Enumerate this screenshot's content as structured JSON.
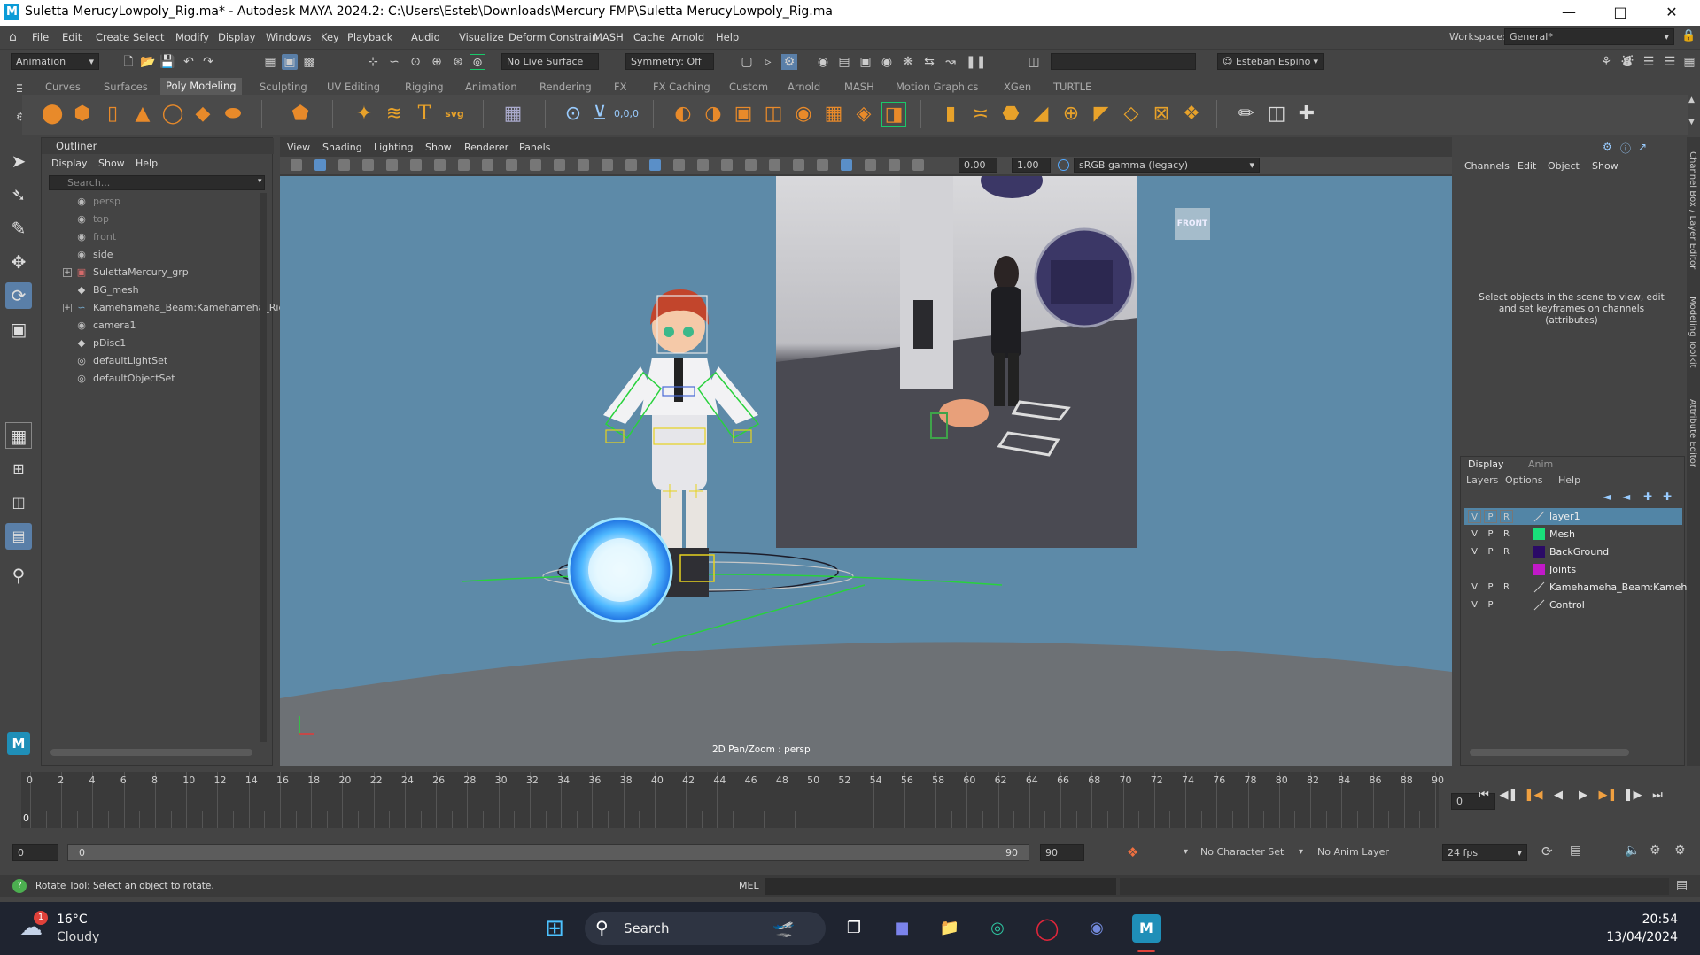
{
  "window": {
    "title": "Suletta MerucyLowpoly_Rig.ma* - Autodesk MAYA 2024.2: C:\\Users\\Esteb\\Downloads\\Mercury FMP\\Suletta MerucyLowpoly_Rig.ma",
    "app_icon": "M"
  },
  "menubar": {
    "items": [
      "File",
      "Edit",
      "Create",
      "Select",
      "Modify",
      "Display",
      "Windows",
      "Key",
      "Playback",
      "Audio",
      "Visualize",
      "Deform",
      "Constrain",
      "MASH",
      "Cache",
      "Arnold",
      "Help"
    ],
    "workspace_label": "Workspace:",
    "workspace_value": "General*"
  },
  "statusline": {
    "menuset": "Animation",
    "live_surface": "No Live Surface",
    "symmetry": "Symmetry: Off",
    "user": "Esteban Espino"
  },
  "shelf_tabs": [
    "Curves",
    "Surfaces",
    "Poly Modeling",
    "Sculpting",
    "UV Editing",
    "Rigging",
    "Animation",
    "Rendering",
    "FX",
    "FX Caching",
    "Custom",
    "Arnold",
    "MASH",
    "Motion Graphics",
    "XGen",
    "TURTLE"
  ],
  "shelf_active": "Poly Modeling",
  "outliner": {
    "title": "Outliner",
    "menu": [
      "Display",
      "Show",
      "Help"
    ],
    "search_placeholder": "Search...",
    "items": [
      {
        "label": "persp",
        "dim": true,
        "expand": false,
        "icon": "camera-icon"
      },
      {
        "label": "top",
        "dim": true,
        "expand": false,
        "icon": "camera-icon"
      },
      {
        "label": "front",
        "dim": true,
        "expand": false,
        "icon": "camera-icon"
      },
      {
        "label": "side",
        "dim": false,
        "expand": false,
        "icon": "camera-icon"
      },
      {
        "label": "SulettaMercury_grp",
        "dim": false,
        "expand": true,
        "icon": "group-icon"
      },
      {
        "label": "BG_mesh",
        "dim": false,
        "expand": false,
        "icon": "mesh-icon"
      },
      {
        "label": "Kamehameha_Beam:Kamehameha_Rig",
        "dim": false,
        "expand": true,
        "icon": "curve-icon"
      },
      {
        "label": "camera1",
        "dim": false,
        "expand": false,
        "icon": "camera-icon"
      },
      {
        "label": "pDisc1",
        "dim": false,
        "expand": false,
        "icon": "mesh-icon"
      },
      {
        "label": "defaultLightSet",
        "dim": false,
        "expand": false,
        "icon": "set-icon"
      },
      {
        "label": "defaultObjectSet",
        "dim": false,
        "expand": false,
        "icon": "set-icon"
      }
    ]
  },
  "viewport": {
    "menu": [
      "View",
      "Shading",
      "Lighting",
      "Show",
      "Renderer",
      "Panels"
    ],
    "exposure": "0.00",
    "gamma": "1.00",
    "colorspace": "sRGB gamma (legacy)",
    "view_cube": "FRONT",
    "hud": "2D Pan/Zoom : persp"
  },
  "channelbox": {
    "menu": [
      "Channels",
      "Edit",
      "Object",
      "Show"
    ],
    "message": "Select objects in the scene to view, edit and set keyframes on channels (attributes)"
  },
  "layers": {
    "tabs": [
      "Display",
      "Anim"
    ],
    "menu": [
      "Layers",
      "Options",
      "Help"
    ],
    "rows": [
      {
        "v": "V",
        "p": "P",
        "r": "R",
        "color": "",
        "name": "layer1",
        "selected": true
      },
      {
        "v": "V",
        "p": "P",
        "r": "R",
        "color": "#19e07a",
        "name": "Mesh",
        "selected": false
      },
      {
        "v": "V",
        "p": "P",
        "r": "R",
        "color": "#2a0a66",
        "name": "BackGround",
        "selected": false
      },
      {
        "v": "",
        "p": "",
        "r": "",
        "color": "#c219c9",
        "name": "Joints",
        "selected": false
      },
      {
        "v": "V",
        "p": "P",
        "r": "R",
        "color": "",
        "name": "Kamehameha_Beam:Kamehameha",
        "selected": false
      },
      {
        "v": "V",
        "p": "P",
        "r": "",
        "color": "",
        "name": "Control",
        "selected": false
      }
    ]
  },
  "right_strip": [
    "Channel Box / Layer Editor",
    "Modeling Toolkit",
    "Attribute Editor"
  ],
  "timeline": {
    "ticks": [
      "0",
      "2",
      "4",
      "6",
      "8",
      "10",
      "12",
      "14",
      "16",
      "18",
      "20",
      "22",
      "24",
      "26",
      "28",
      "30",
      "32",
      "34",
      "36",
      "38",
      "40",
      "42",
      "44",
      "46",
      "48",
      "50",
      "52",
      "54",
      "56",
      "58",
      "60",
      "62",
      "64",
      "66",
      "68",
      "70",
      "72",
      "74",
      "76",
      "78",
      "80",
      "82",
      "84",
      "86",
      "88",
      "90"
    ],
    "current_frame": "0",
    "current_marker": "0"
  },
  "range": {
    "start": "0",
    "inner_start": "0",
    "inner_end": "90",
    "end": "90",
    "character_set": "No Character Set",
    "anim_layer": "No Anim Layer",
    "fps": "24 fps"
  },
  "cmdline": {
    "status": "Rotate Tool: Select an object to rotate.",
    "lang": "MEL"
  },
  "taskbar": {
    "weather_temp": "16°C",
    "weather_desc": "Cloudy",
    "weather_badge": "1",
    "search_label": "Search",
    "time": "20:54",
    "date": "13/04/2024"
  }
}
